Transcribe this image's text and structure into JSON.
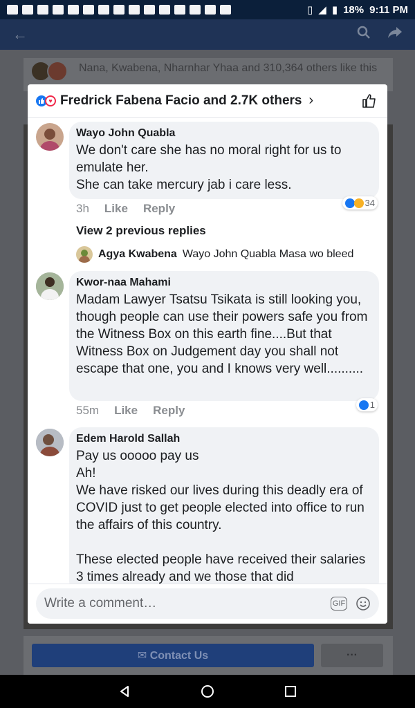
{
  "status_bar": {
    "battery": "18%",
    "time": "9:11 PM"
  },
  "background": {
    "likes_text": "Nana, Kwabena, Nharnhar Yhaa and 310,364 others like this",
    "contact_button": "✉ Contact Us",
    "more_button": "···"
  },
  "modal": {
    "header": "Fredrick Fabena Facio and 2.7K others",
    "comments": [
      {
        "author": "Wayo John Quabla",
        "text": "We don't care she has no moral right for us to emulate her.\nShe can take mercury jab i care less.",
        "time": "3h",
        "like": "Like",
        "reply": "Reply",
        "reaction_count": "34"
      },
      {
        "author": "Kwor-naa Mahami",
        "text": "Madam Lawyer Tsatsu Tsikata is still looking you, though people can use their powers safe you from the Witness Box on this earth fine....But that Witness Box on Judgement day you shall not escape that one, you and I knows very well..........",
        "time": "55m",
        "like": "Like",
        "reply": "Reply",
        "reaction_count": "1"
      },
      {
        "author": "Edem Harold Sallah",
        "text": "Pay us ooooo pay us\nAh!\nWe have risked our lives during this deadly era of COVID just to get people elected into office to run the affairs of this country.\n\nThese elected people have received their salaries 3 times already and we those that did"
      }
    ],
    "view_replies": "View 2 previous replies",
    "reply_preview": {
      "author": "Agya Kwabena",
      "text": "Wayo John Quabla Masa wo bleed"
    },
    "composer_placeholder": "Write a comment…",
    "gif_label": "GIF"
  }
}
